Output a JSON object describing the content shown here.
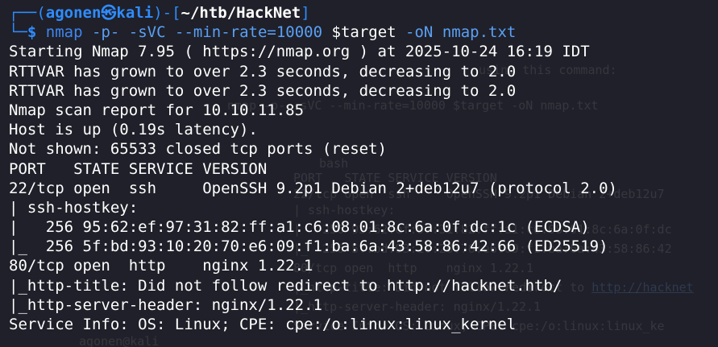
{
  "prompt": {
    "corner_top": "┌──(",
    "user": "agonen",
    "skull": "㉿",
    "host": "kali",
    "mid": ")-[",
    "path": "~/htb/HackNet",
    "close": "]",
    "corner_bottom": "└─",
    "dollar": "$"
  },
  "command": {
    "program": "nmap",
    "args1": "-p-",
    "args2": "-sVC",
    "args3": "--min-rate=10000",
    "target": "$target",
    "args4": "-oN",
    "outfile": "nmap.txt"
  },
  "output": [
    "Starting Nmap 7.95 ( https://nmap.org ) at 2025-10-24 16:19 IDT",
    "RTTVAR has grown to over 2.3 seconds, decreasing to 2.0",
    "RTTVAR has grown to over 2.3 seconds, decreasing to 2.0",
    "Nmap scan report for 10.10.11.85",
    "Host is up (0.19s latency).",
    "Not shown: 65533 closed tcp ports (reset)",
    "PORT   STATE SERVICE VERSION",
    "22/tcp open  ssh     OpenSSH 9.2p1 Debian 2+deb12u7 (protocol 2.0)",
    "| ssh-hostkey:",
    "|   256 95:62:ef:97:31:82:ff:a1:c6:08:01:8c:6a:0f:dc:1c (ECDSA)",
    "|_  256 5f:bd:93:10:20:70:e6:09:f1:ba:6a:43:58:86:42:66 (ED25519)",
    "80/tcp open  http    nginx 1.22.1",
    "|_http-title: Did not follow redirect to http://hacknet.htb/",
    "|_http-server-header: nginx/1.22.1",
    "Service Info: OS: Linux; CPE: cpe:/o:linux:linux_kernel"
  ],
  "ghost": {
    "l1": "using this command:",
    "l2": "nmap -p- -sVC --min-rate=10000 $target -oN nmap.txt",
    "l3": "bash",
    "l4": "PORT   STATE SERVICE VERSION",
    "l5": "22/tcp open  ssh     OpenSSH 9.2p1 Debian 2+deb12u7",
    "l6": "| ssh-hostkey:",
    "l7": "|   256 95:62:ef:97:31:82:ff:a1:c6:08:01:8c:6a:0f:dc",
    "l8": "|_  256 5f:bd:93:10:20:70:e6:09:f1:ba:6a:43:58:86:42",
    "l9": "80/tcp open  http    nginx 1.22.1",
    "l10a": "|_http-title: Did not follow redirect to ",
    "l10b": "http://hacknet",
    "l11": "|_http-server-header: nginx/1.22.1",
    "l12": "Service Info: OS: Linux; CPE: cpe:/o:linux:linux_ke",
    "l13": "agonen@kali"
  }
}
